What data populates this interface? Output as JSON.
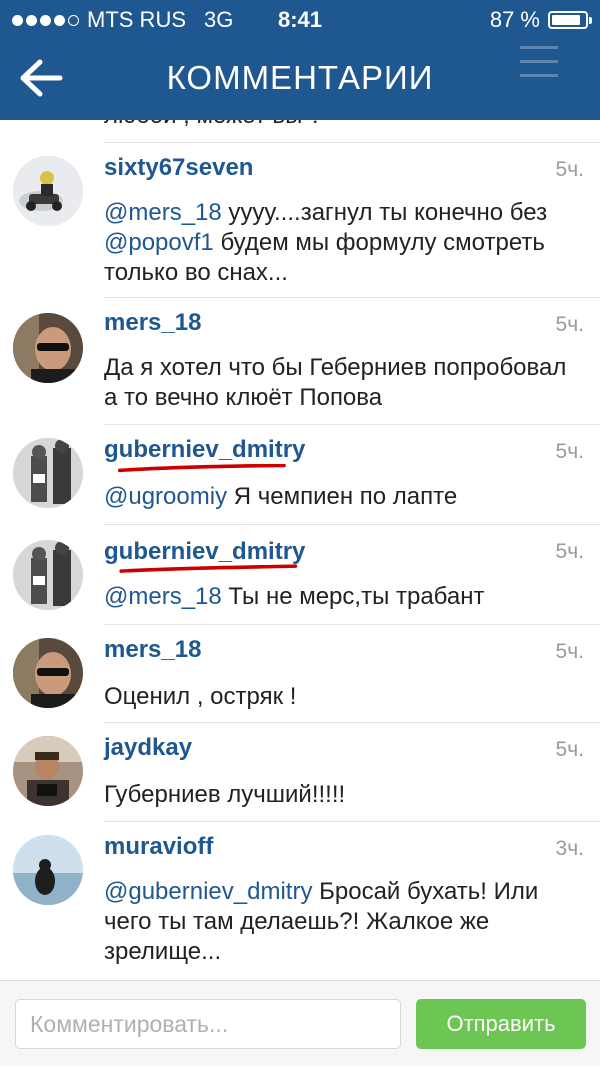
{
  "status_bar": {
    "carrier": "MTS RUS",
    "network": "3G",
    "time": "8:41",
    "battery_text": "87 %",
    "battery_level": 0.87
  },
  "navbar": {
    "back_icon": "arrow-left-icon",
    "title": "КОММЕНТАРИИ",
    "menu_icon": "hamburger-menu-icon"
  },
  "partial_comment_text": "любой , может вы ?",
  "comments": [
    {
      "username": "sixty67seven",
      "time": "5ч.",
      "avatar": "karting-photo",
      "parts": [
        {
          "text": "@mers_18",
          "mention": true
        },
        {
          "text": " уууу....загнул ты конечно без ",
          "mention": false
        },
        {
          "text": "@popovf1",
          "mention": true
        },
        {
          "text": " будем мы формулу смотреть только во снах...",
          "mention": false
        }
      ]
    },
    {
      "username": "mers_18",
      "time": "5ч.",
      "avatar": "man-sunglasses-photo",
      "parts": [
        {
          "text": "Да я хотел что бы Геберниев попробовал а то вечно клюёт Попова",
          "mention": false
        }
      ]
    },
    {
      "username": "guberniev_dmitry",
      "time": "5ч.",
      "avatar": "kids-bw-photo",
      "parts": [
        {
          "text": "@ugroomiy",
          "mention": true
        },
        {
          "text": " Я чемпиен по лапте",
          "mention": false
        }
      ]
    },
    {
      "username": "guberniev_dmitry",
      "time": "5ч.",
      "avatar": "kids-bw-photo",
      "parts": [
        {
          "text": "@mers_18",
          "mention": true
        },
        {
          "text": " Ты не мерс,ты трабант",
          "mention": false
        }
      ]
    },
    {
      "username": "mers_18",
      "time": "5ч.",
      "avatar": "man-sunglasses-photo",
      "parts": [
        {
          "text": "Оценил , остряк !",
          "mention": false
        }
      ]
    },
    {
      "username": "jaydkay",
      "time": "5ч.",
      "avatar": "man-camera-photo",
      "parts": [
        {
          "text": "Губерниев лучший!!!!!",
          "mention": false
        }
      ]
    },
    {
      "username": "muravioff",
      "time": "3ч.",
      "avatar": "sea-silhouette-photo",
      "parts": [
        {
          "text": "@guberniev_dmitry",
          "mention": true
        },
        {
          "text": " Бросай бухать! Или чего ты там делаешь?! Жалкое же зрелище...",
          "mention": false
        }
      ]
    }
  ],
  "input_bar": {
    "placeholder": "Комментировать...",
    "value": "",
    "send_label": "Отправить"
  },
  "colors": {
    "header": "#1f5790",
    "username": "#1f5790",
    "send_button": "#6dc554",
    "underline_annotation": "#cc0000"
  }
}
